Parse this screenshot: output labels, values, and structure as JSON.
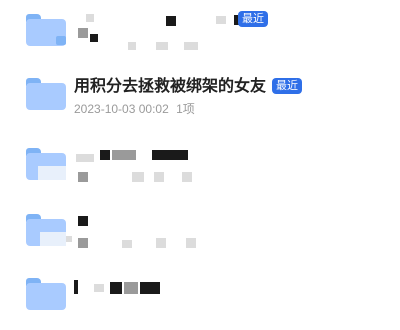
{
  "colors": {
    "folder_back": "#7fb3f5",
    "folder_front": "#a9cbff",
    "badge_bg": "#2f6fe8",
    "redacted_dark": "#1a1a1a",
    "redacted_gray": "#9a9a9a",
    "redacted_light": "#dcdcdc"
  },
  "folders": [
    {
      "icon": "folder-video-icon",
      "badge": "最近"
    },
    {
      "icon": "folder-icon",
      "title": "用积分去拯救被绑架的女友",
      "badge": "最近",
      "date": "2023-10-03 00:02",
      "count": "1项"
    },
    {
      "icon": "folder-icon"
    },
    {
      "icon": "folder-icon"
    },
    {
      "icon": "folder-icon"
    }
  ]
}
